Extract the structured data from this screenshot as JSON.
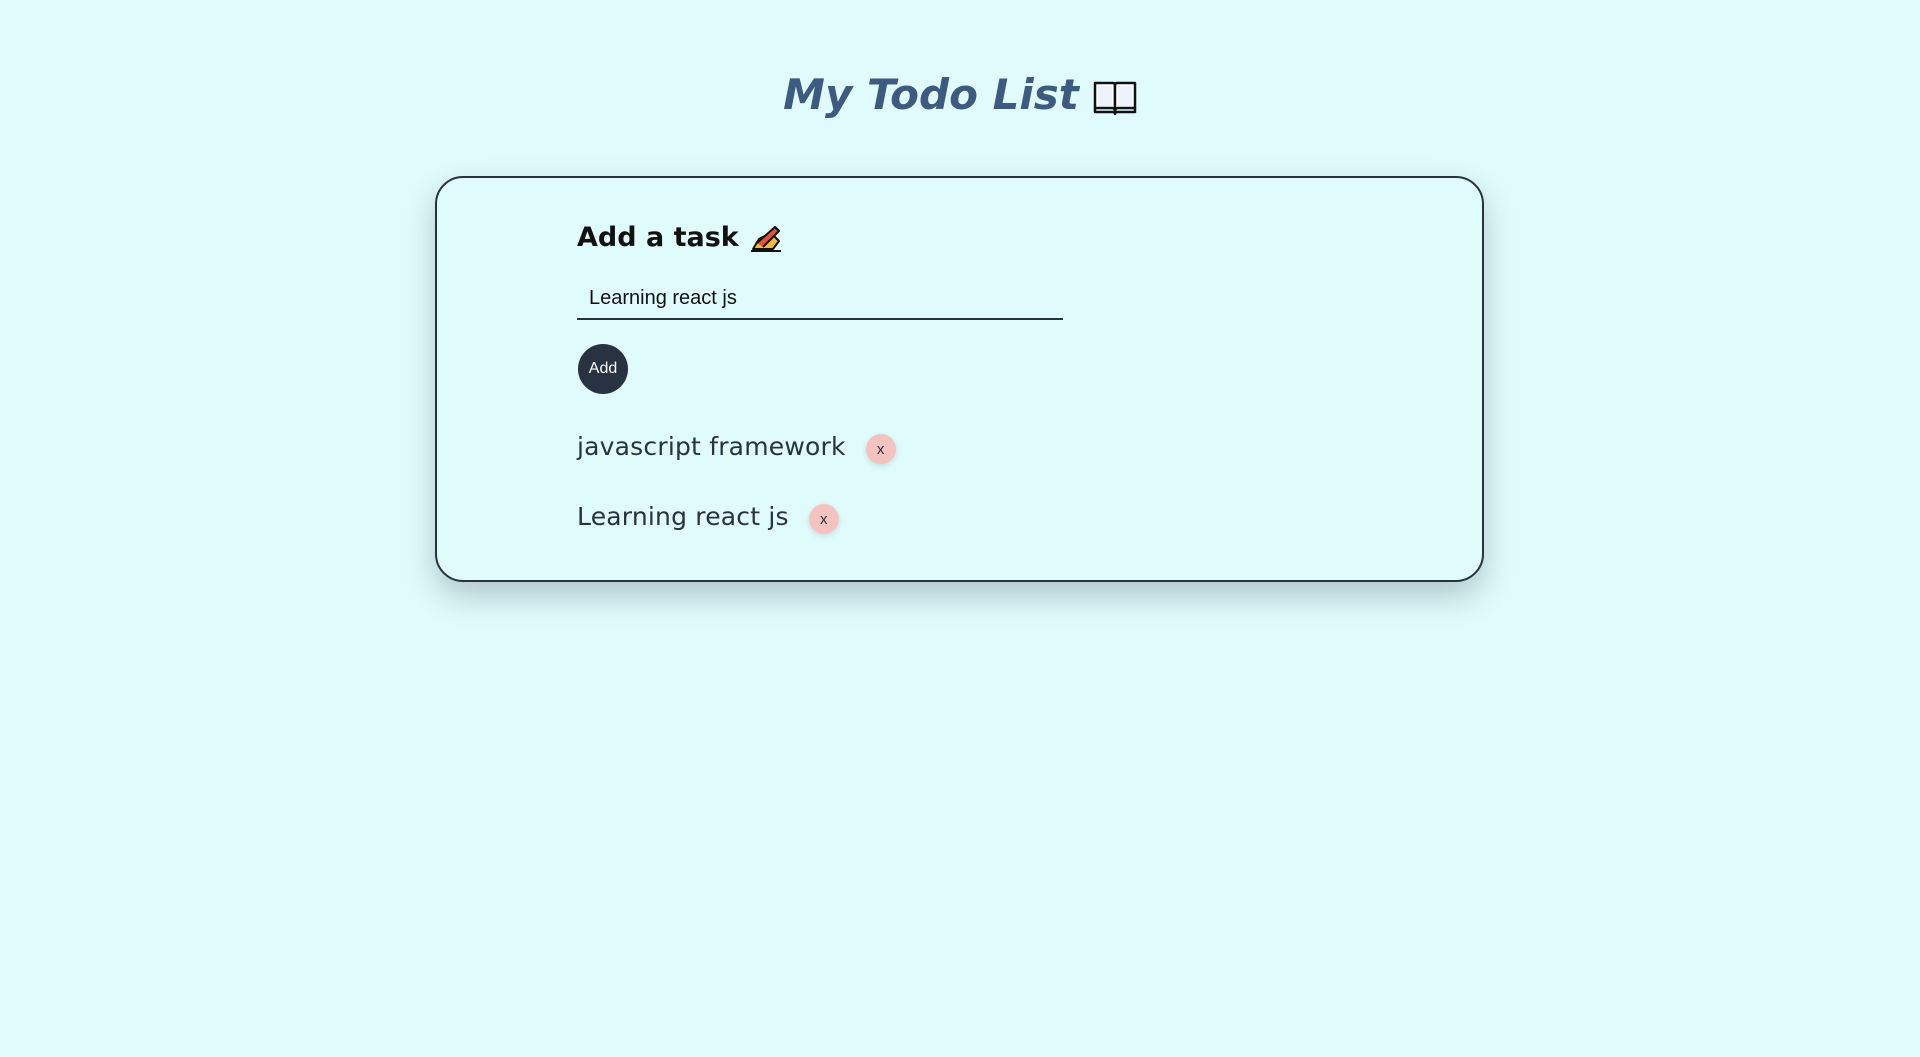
{
  "header": {
    "title": "My Todo List",
    "title_icon": "open-book-icon"
  },
  "form": {
    "heading": "Add a task",
    "heading_icon": "writing-hand-icon",
    "input_value": "Learning react js",
    "add_label": "Add"
  },
  "todos": [
    {
      "text": "javascript framework",
      "remove_label": "x"
    },
    {
      "text": "Learning react js",
      "remove_label": "x"
    }
  ],
  "colors": {
    "background": "#e0fbfc",
    "title": "#3d5a80",
    "dark": "#293241",
    "remove_button": "#f4c3bf"
  }
}
